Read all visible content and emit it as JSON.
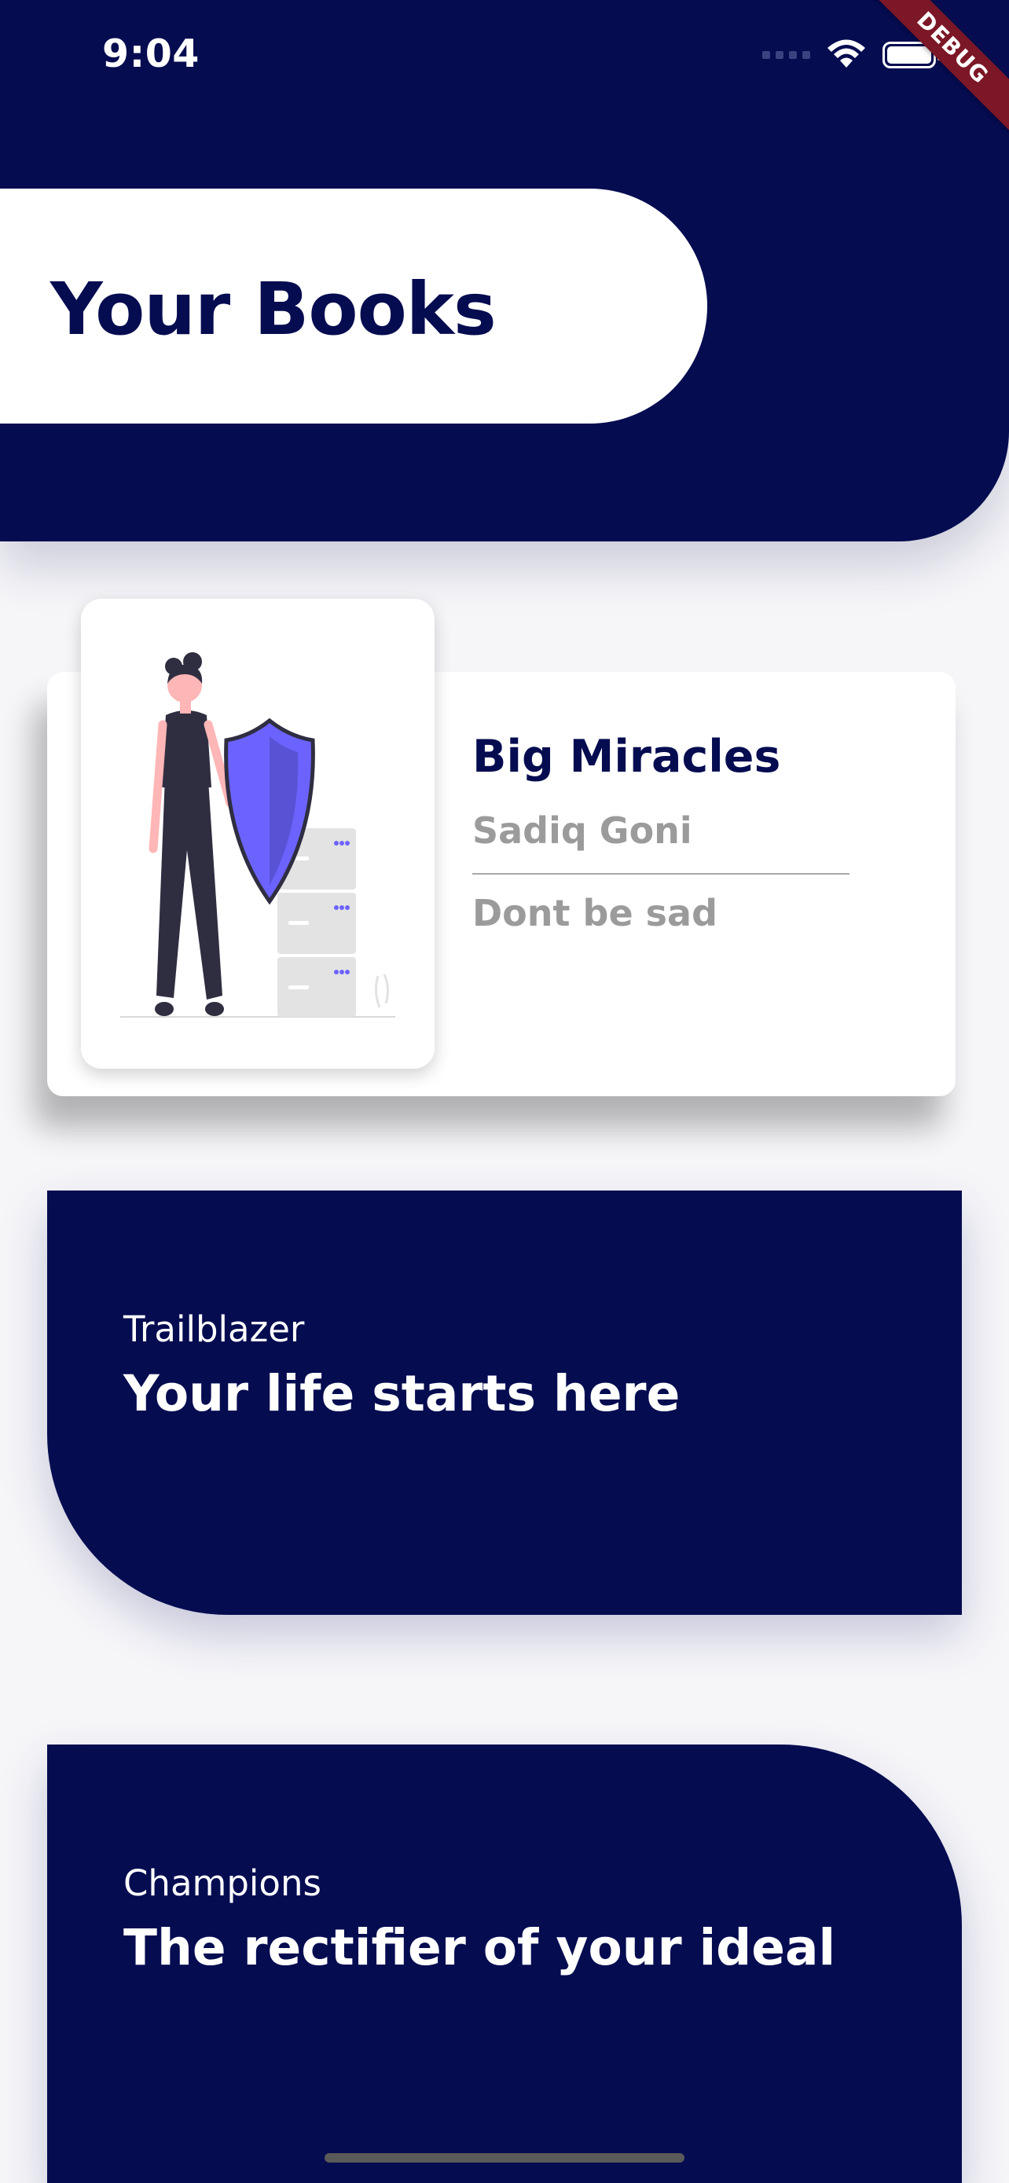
{
  "status_bar": {
    "time": "9:04",
    "icons": [
      "cellular-signal-icon",
      "wifi-icon",
      "battery-icon"
    ]
  },
  "debug_banner": "DEBUG",
  "header": {
    "title": "Your Books"
  },
  "book": {
    "title": "Big Miracles",
    "author": "Sadiq Goni",
    "description": "Dont be sad",
    "cover_icon": "person-with-shield-illustration"
  },
  "promos": [
    {
      "subtitle": "Trailblazer",
      "headline": "Your life starts here"
    },
    {
      "subtitle": "Champions",
      "headline": "The rectifier of your ideal"
    }
  ],
  "colors": {
    "navy": "#050c50",
    "accent": "#6c63ff",
    "grey_text": "#9b9b9b",
    "debug_red": "#7b1726"
  }
}
